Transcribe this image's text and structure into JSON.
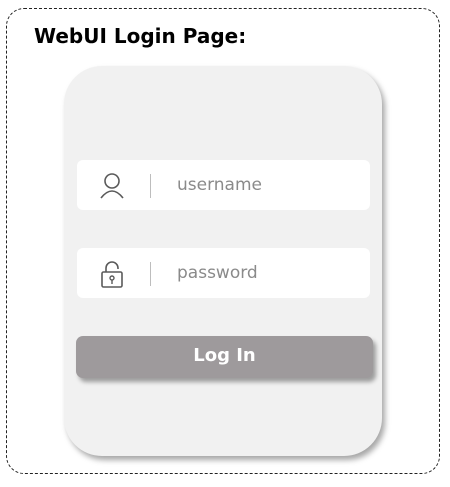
{
  "page": {
    "title": "WebUI Login Page:"
  },
  "login_form": {
    "username": {
      "placeholder": "username",
      "icon": "user-icon"
    },
    "password": {
      "placeholder": "password",
      "icon": "lock-icon"
    },
    "submit_label": "Log In"
  },
  "colors": {
    "card_background": "#f1f1f1",
    "field_background": "#ffffff",
    "placeholder_text": "#8a8a8a",
    "button_background": "#9e9a9c",
    "button_text": "#ffffff"
  }
}
